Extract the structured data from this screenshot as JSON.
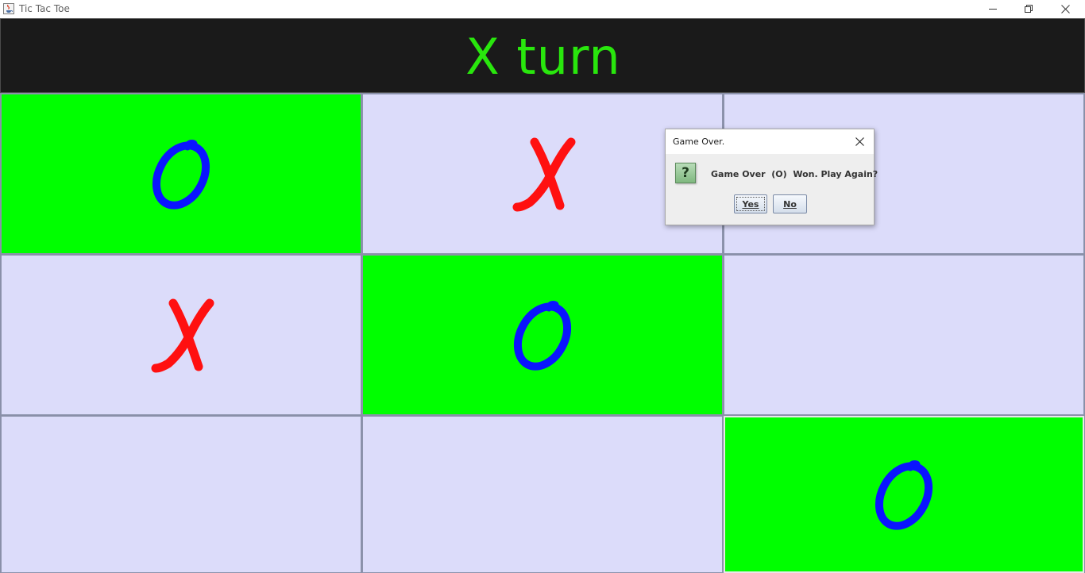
{
  "window": {
    "title": "Tic Tac Toe",
    "icon": "java-cup-icon",
    "controls": [
      "minimize-icon",
      "restore-icon",
      "close-icon"
    ]
  },
  "header": {
    "turn_text": "X turn",
    "background": "#1a1a1a",
    "text_color": "#29e60d"
  },
  "board": {
    "cells": [
      {
        "mark": "O",
        "highlighted": true
      },
      {
        "mark": "X",
        "highlighted": false
      },
      {
        "mark": "",
        "highlighted": false
      },
      {
        "mark": "X",
        "highlighted": false
      },
      {
        "mark": "O",
        "highlighted": true
      },
      {
        "mark": "",
        "highlighted": false
      },
      {
        "mark": "",
        "highlighted": false
      },
      {
        "mark": "",
        "highlighted": false
      },
      {
        "mark": "O",
        "highlighted": true
      }
    ],
    "colors": {
      "cell": "#dcdcfa",
      "win_cell": "#00ff00",
      "x_mark": "#ff1010",
      "o_mark": "#0a14ff"
    }
  },
  "dialog": {
    "title": "Game Over.",
    "icon": "question-icon",
    "icon_glyph": "?",
    "message": "Game Over  (O)  Won. Play Again?",
    "yes_label": "Yes",
    "no_label": "No"
  }
}
